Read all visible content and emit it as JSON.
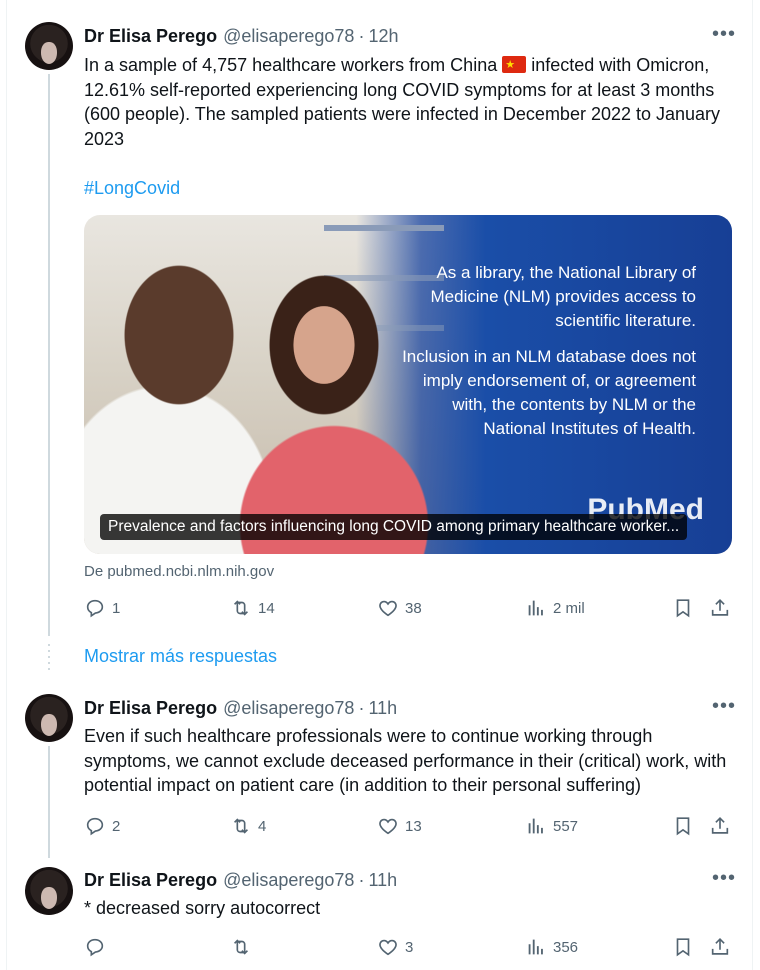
{
  "posts": [
    {
      "author_name": "Dr Elisa Perego",
      "handle": "@elisaperego78",
      "separator": "·",
      "time": "12h",
      "more_icon": "more-icon",
      "text_part1": "In a sample of 4,757 healthcare workers from China",
      "text_part2": " infected with Omicron, 12.61% self-reported experiencing long COVID symptoms for at least 3 months (600 people). The sampled patients were infected in December 2022 to January 2023",
      "hashtag": "#LongCovid",
      "card": {
        "overlay_p1": "As a library, the National Library of Medicine (NLM) provides access to scientific literature.",
        "overlay_p2": "Inclusion in an NLM database does not imply endorsement of, or agreement with, the contents by NLM or the National Institutes of Health.",
        "logo_text": "PubMed",
        "caption": "Prevalence and factors influencing long COVID among primary healthcare worker..."
      },
      "source": "De pubmed.ncbi.nlm.nih.gov",
      "replies": "1",
      "reposts": "14",
      "likes": "38",
      "views": "2 mil"
    },
    {
      "author_name": "Dr Elisa Perego",
      "handle": "@elisaperego78",
      "separator": "·",
      "time": "11h",
      "text": "Even if such healthcare professionals were to continue working through symptoms, we cannot exclude deceased performance in their (critical) work, with potential impact on patient care (in addition to their personal suffering)",
      "replies": "2",
      "reposts": "4",
      "likes": "13",
      "views": "557"
    },
    {
      "author_name": "Dr Elisa Perego",
      "handle": "@elisaperego78",
      "separator": "·",
      "time": "11h",
      "text": "* decreased sorry autocorrect",
      "replies": "",
      "reposts": "",
      "likes": "3",
      "views": "356"
    }
  ],
  "show_more_label": "Mostrar más respuestas",
  "colors": {
    "accent": "#1d9bf0",
    "secondary_text": "#536471",
    "primary_text": "#0f1419",
    "thread_line": "#cfd9de",
    "card_blue": "#1a4ea8"
  }
}
